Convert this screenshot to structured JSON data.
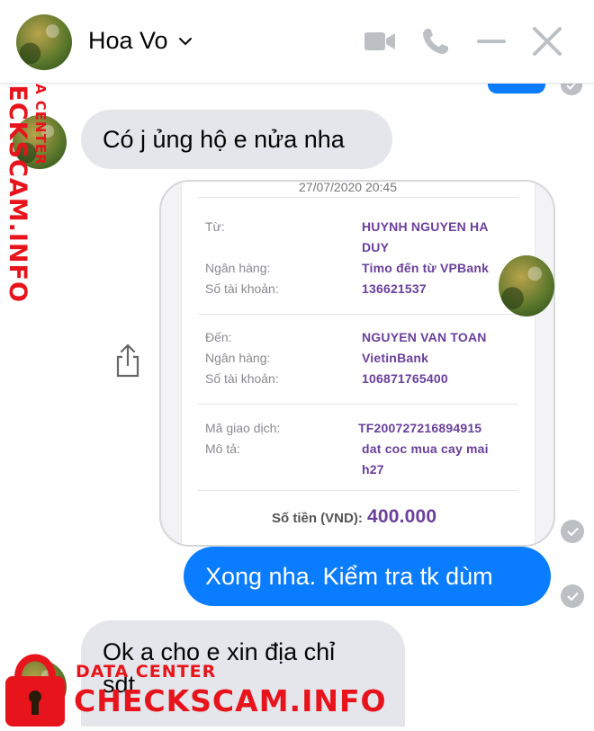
{
  "header": {
    "contact_name": "Hoa Vo",
    "icons": [
      "video-call-icon",
      "phone-icon",
      "minimize-icon",
      "close-icon"
    ]
  },
  "messages": {
    "msg1": "Có j ủng hộ e nửa nha",
    "msg2": "Xong nha. Kiểm tra tk dùm",
    "msg3_line1": "Ok a cho e xin địa chỉ",
    "msg3_line2": "sdt"
  },
  "receipt": {
    "datetime": "27/07/2020 20:45",
    "from_label": "Từ:",
    "from_value_line1": "HUYNH NGUYEN HA",
    "from_value_line2": "DUY",
    "bank_label": "Ngân hàng:",
    "from_bank": "Timo đến từ VPBank",
    "account_label": "Số tài khoản:",
    "from_account": "136621537",
    "to_label": "Đến:",
    "to_value": "NGUYEN VAN TOAN",
    "to_bank": "VietinBank",
    "to_account": "106871765400",
    "txn_label": "Mã giao dịch:",
    "txn_value": "TF200727216894915",
    "desc_label": "Mô tả:",
    "desc_line1": "dat coc mua cay mai",
    "desc_line2": "h27",
    "amount_label": "Số tiền (VND):",
    "amount_value": "400.000"
  },
  "watermark": {
    "vertical_small": "DATA CENTER",
    "vertical_big": "CHECKSCAM.INFO",
    "bottom_small": "DATA CENTER",
    "bottom_big": "CHECKSCAM.INFO"
  },
  "colors": {
    "accent": "#0a7cff",
    "incoming_bubble": "#e4e6eb",
    "watermark": "#e8141c",
    "receipt_value": "#6a3f9c"
  }
}
